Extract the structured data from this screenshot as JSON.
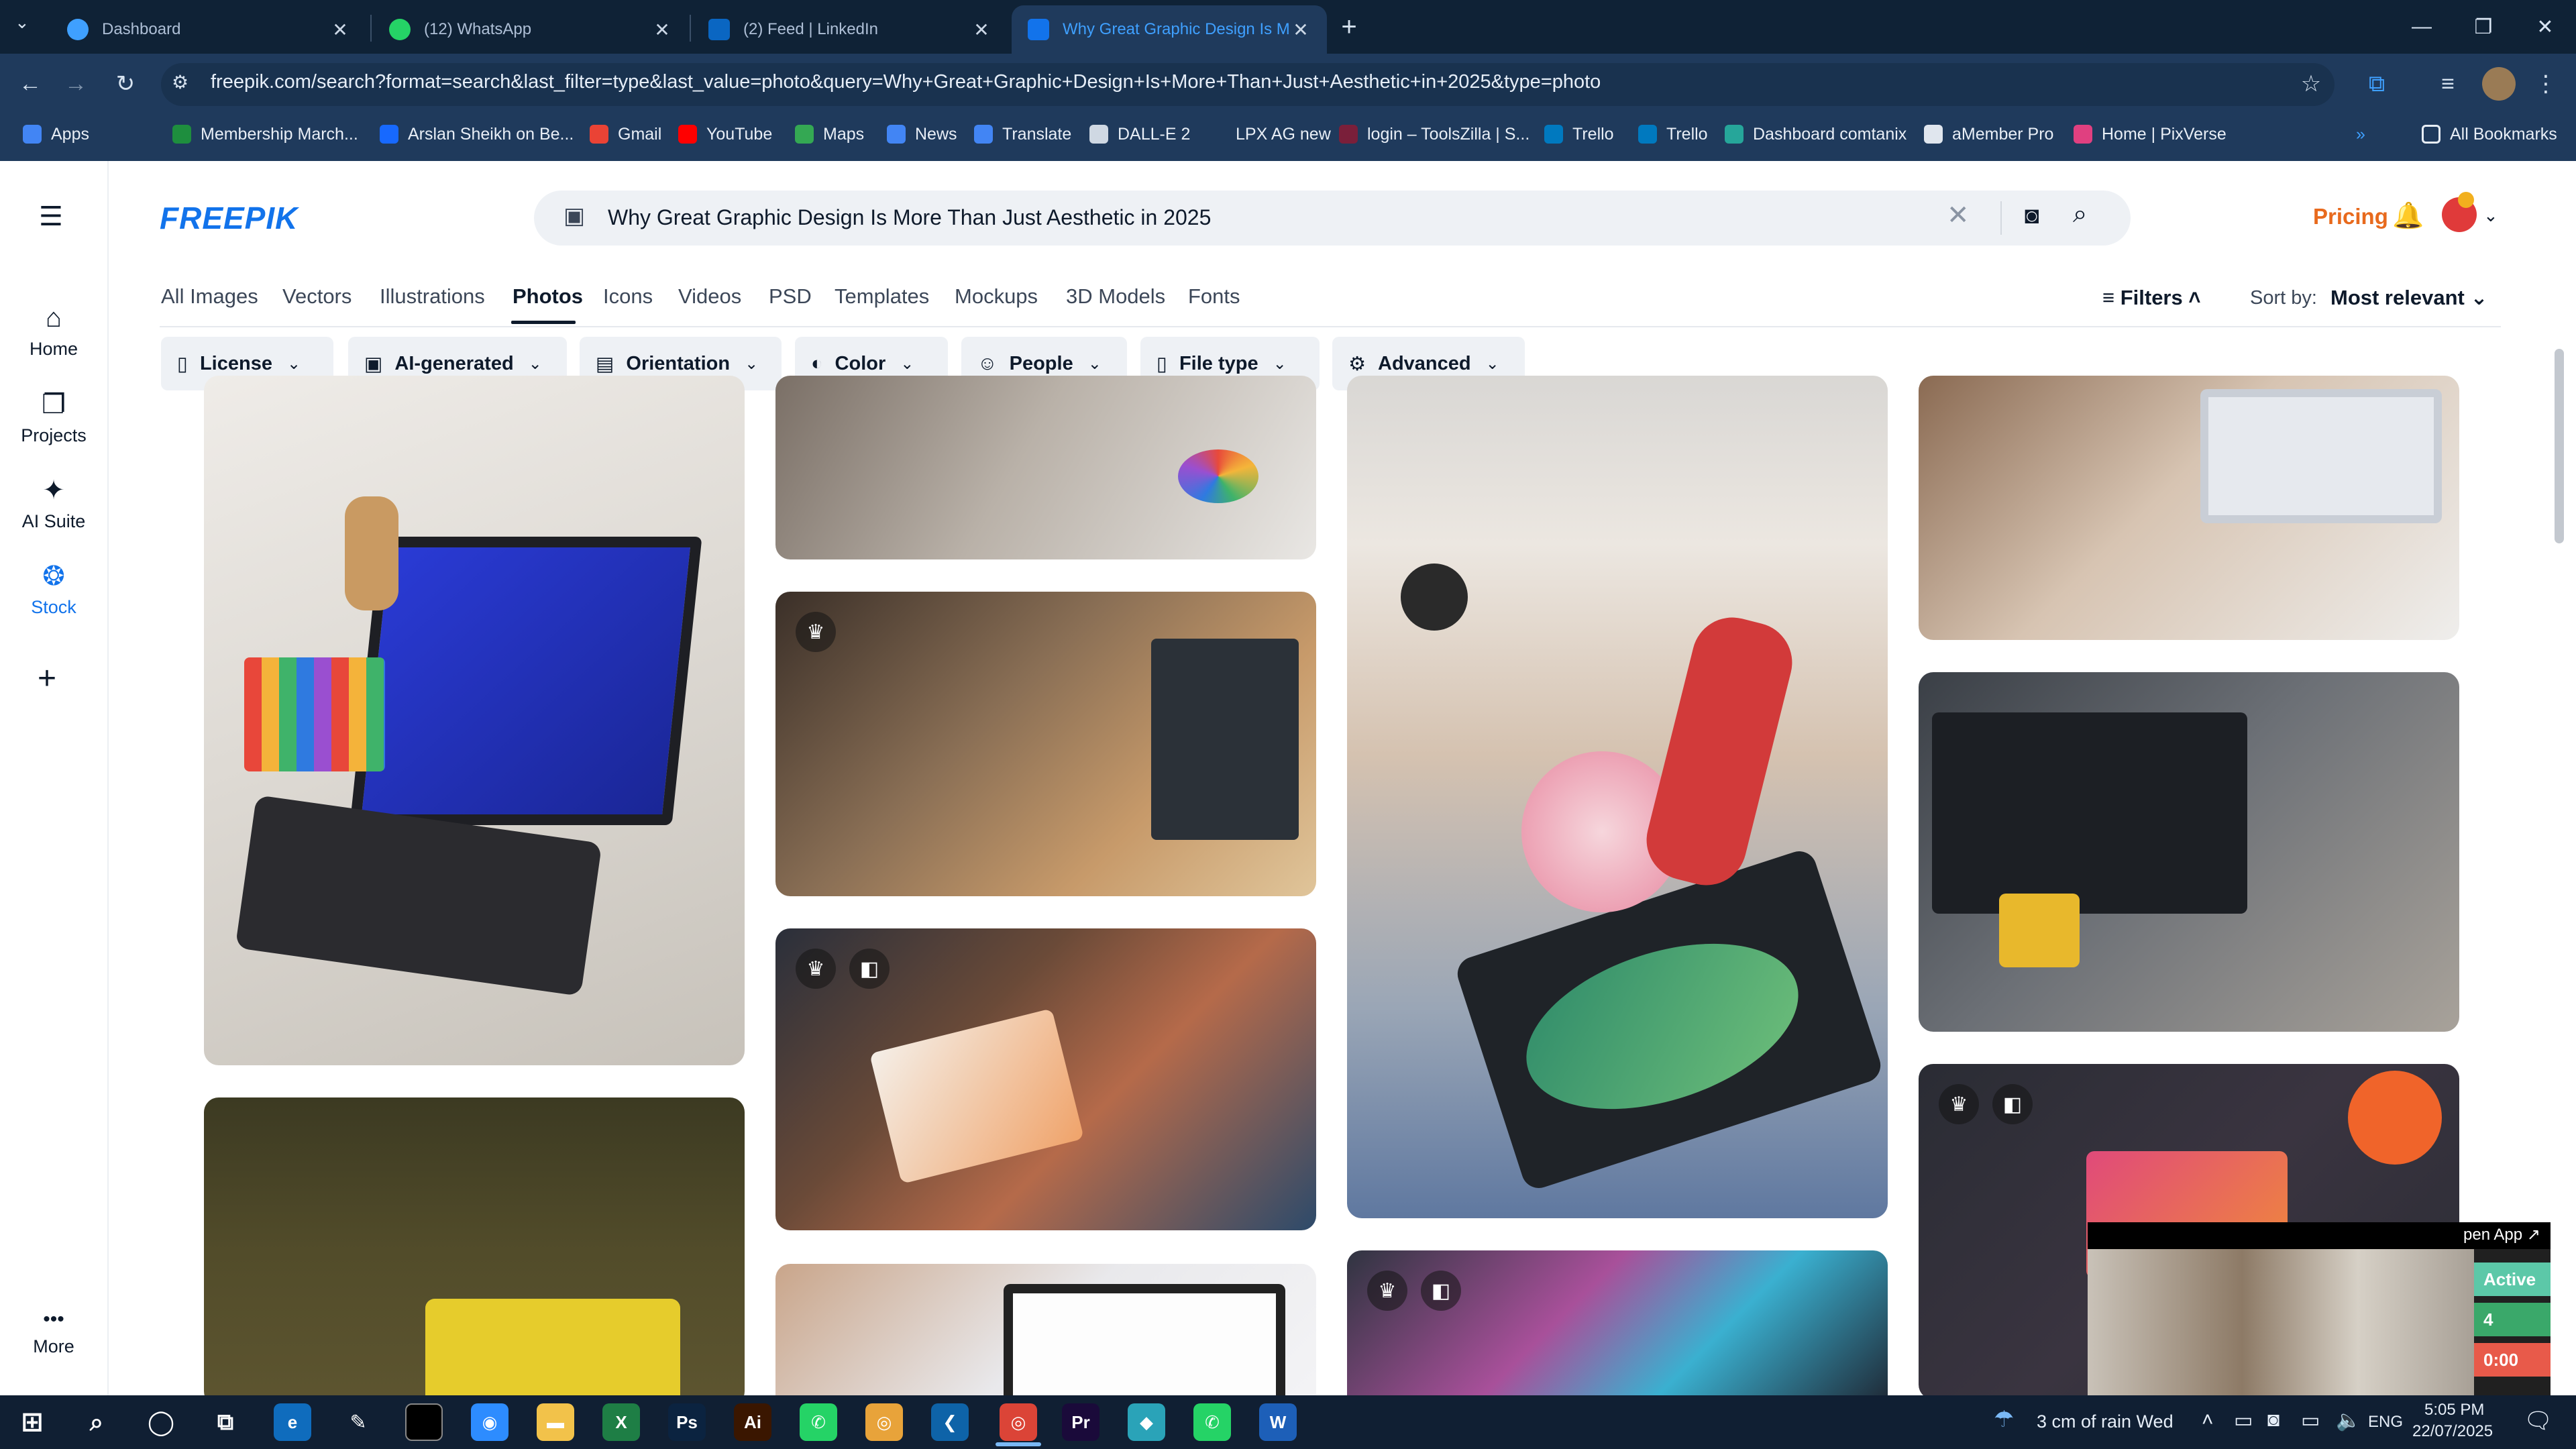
{
  "browser": {
    "tabs": [
      {
        "title": "Dashboard",
        "active": false
      },
      {
        "title": "(12) WhatsApp",
        "active": false
      },
      {
        "title": "(2) Feed | LinkedIn",
        "active": false
      },
      {
        "title": "Why Great Graphic Design Is M",
        "active": true
      }
    ],
    "new_tab_label": "+",
    "url": "freepik.com/search?format=search&last_filter=type&last_value=photo&query=Why+Great+Graphic+Design+Is+More+Than+Just+Aesthetic+in+2025&type=photo",
    "bookmarks": [
      {
        "label": "Apps",
        "icon": "apps-grid-icon",
        "color": "#4285f4"
      },
      {
        "label": "Membership March...",
        "icon": "sheet-icon",
        "color": "#1e8e3e"
      },
      {
        "label": "Arslan Sheikh on Be...",
        "icon": "behance-icon",
        "color": "#1769ff"
      },
      {
        "label": "Gmail",
        "icon": "gmail-icon",
        "color": "#ea4335"
      },
      {
        "label": "YouTube",
        "icon": "youtube-icon",
        "color": "#ff0000"
      },
      {
        "label": "Maps",
        "icon": "maps-icon",
        "color": "#34a853"
      },
      {
        "label": "News",
        "icon": "news-icon",
        "color": "#4285f4"
      },
      {
        "label": "Translate",
        "icon": "translate-icon",
        "color": "#4285f4"
      },
      {
        "label": "DALL-E 2",
        "icon": "openai-icon",
        "color": "#cfd8e3"
      },
      {
        "label": "LPX AG new",
        "icon": "lpx-icon",
        "color": "#1f3a5c"
      },
      {
        "label": "login – ToolsZilla | S...",
        "icon": "toolszilla-icon",
        "color": "#7a1f3a"
      },
      {
        "label": "Trello",
        "icon": "trello-icon",
        "color": "#0079bf"
      },
      {
        "label": "Trello",
        "icon": "trello-icon",
        "color": "#0079bf"
      },
      {
        "label": "Dashboard comtanix",
        "icon": "comtanix-icon",
        "color": "#26a69a"
      },
      {
        "label": "aMember Pro",
        "icon": "amember-icon",
        "color": "#e0e6ee"
      },
      {
        "label": "Home | PixVerse",
        "icon": "pixverse-icon",
        "color": "#e04080"
      }
    ],
    "all_bookmarks": "All Bookmarks"
  },
  "rail": [
    {
      "label": "Home",
      "icon": "home-icon",
      "glyph": "⌂"
    },
    {
      "label": "Projects",
      "icon": "projects-icon",
      "glyph": "❐"
    },
    {
      "label": "AI Suite",
      "icon": "ai-suite-icon",
      "glyph": "✦"
    },
    {
      "label": "Stock",
      "icon": "stock-icon",
      "glyph": "❂"
    },
    {
      "label": "More",
      "icon": "more-icon",
      "glyph": "•••"
    }
  ],
  "header": {
    "logo": "FREEPIK",
    "search_query": "Why Great Graphic Design Is More Than Just Aesthetic in 2025",
    "pricing": "Pricing"
  },
  "categories": [
    "All Images",
    "Vectors",
    "Illustrations",
    "Photos",
    "Icons",
    "Videos",
    "PSD",
    "Templates",
    "Mockups",
    "3D Models",
    "Fonts"
  ],
  "active_category": "Photos",
  "toolbar": {
    "filters": "Filters",
    "sort_label": "Sort by:",
    "sort_value": "Most relevant"
  },
  "filters": [
    {
      "label": "License",
      "icon": "license-icon"
    },
    {
      "label": "AI-generated",
      "icon": "ai-generated-icon"
    },
    {
      "label": "Orientation",
      "icon": "orientation-icon"
    },
    {
      "label": "Color",
      "icon": "palette-icon"
    },
    {
      "label": "People",
      "icon": "people-icon"
    },
    {
      "label": "File type",
      "icon": "file-icon"
    },
    {
      "label": "Advanced",
      "icon": "gear-icon"
    }
  ],
  "photos": [
    {
      "name": "photo-laptop-drawing-tablet",
      "premium": false
    },
    {
      "name": "photo-desk-closeup",
      "premium": false
    },
    {
      "name": "photo-designer-at-desk",
      "premium": true
    },
    {
      "name": "photo-woman-tablet-artwork",
      "premium": true
    },
    {
      "name": "photo-creative-design-screen",
      "premium": false
    },
    {
      "name": "photo-yellow-box-blurred",
      "premium": false
    },
    {
      "name": "photo-woman-drawing-dragonfly",
      "premium": false
    },
    {
      "name": "photo-colorful-splash-portrait",
      "premium": true
    },
    {
      "name": "photo-designers-desk-monitor",
      "premium": false
    },
    {
      "name": "photo-designer-workstation",
      "premium": false
    },
    {
      "name": "photo-flatlay-design-tools",
      "premium": true
    }
  ],
  "pip": {
    "open_app": "pen App ↗",
    "status1": "Active",
    "status2": "4",
    "status3": "0:00"
  },
  "taskbar": {
    "apps": [
      "Zoom",
      "Files",
      "Excel",
      "Photoshop",
      "Illustrator",
      "Chrome",
      "VS Code",
      "Premiere",
      "Word"
    ],
    "weather": "3 cm of rain Wed",
    "lang": "ENG",
    "time": "5:05 PM",
    "date": "22/07/2025"
  }
}
